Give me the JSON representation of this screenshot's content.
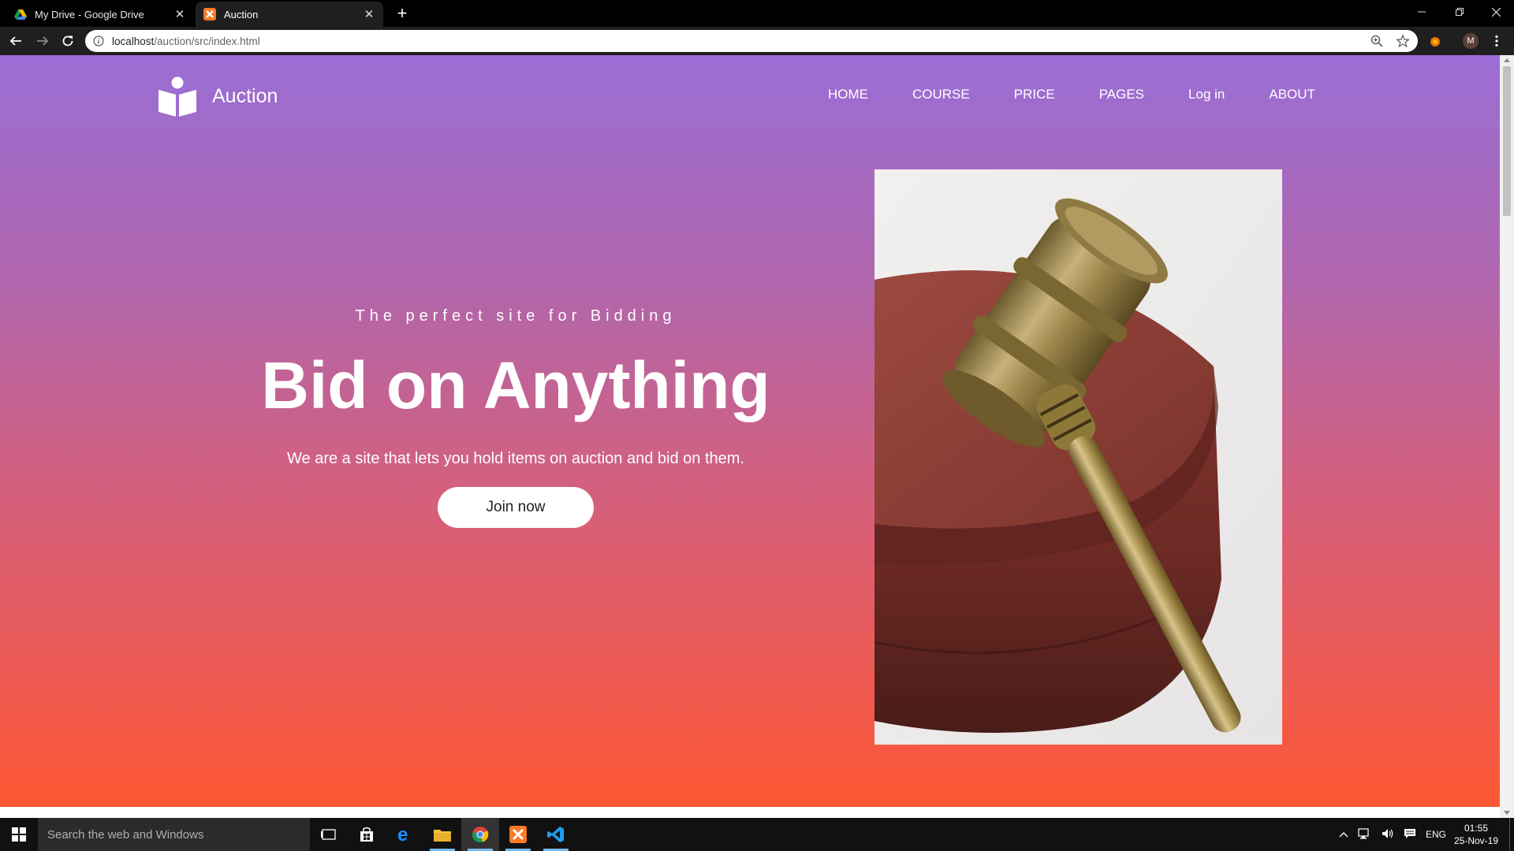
{
  "browser": {
    "tabs": [
      {
        "title": "My Drive - Google Drive",
        "close": "✕"
      },
      {
        "title": "Auction",
        "close": "✕"
      }
    ],
    "new_tab": "+",
    "url_host": "localhost",
    "url_path": "/auction/src/index.html",
    "profile_initial": "M"
  },
  "site": {
    "logo_text": "Auction",
    "nav": [
      "HOME",
      "COURSE",
      "PRICE",
      "PAGES",
      "Log in",
      "ABOUT"
    ],
    "hero": {
      "tagline": "The perfect site for Bidding",
      "headline": "Bid on Anything",
      "description": "We are a site that lets you hold items on auction and bid on them.",
      "cta": "Join now"
    },
    "colors": {
      "gradient_top": "#9b6ed6",
      "gradient_bottom": "#fd5733"
    }
  },
  "taskbar": {
    "search_placeholder": "Search the web and Windows",
    "language": "ENG",
    "time": "01:55",
    "date": "25-Nov-19"
  }
}
